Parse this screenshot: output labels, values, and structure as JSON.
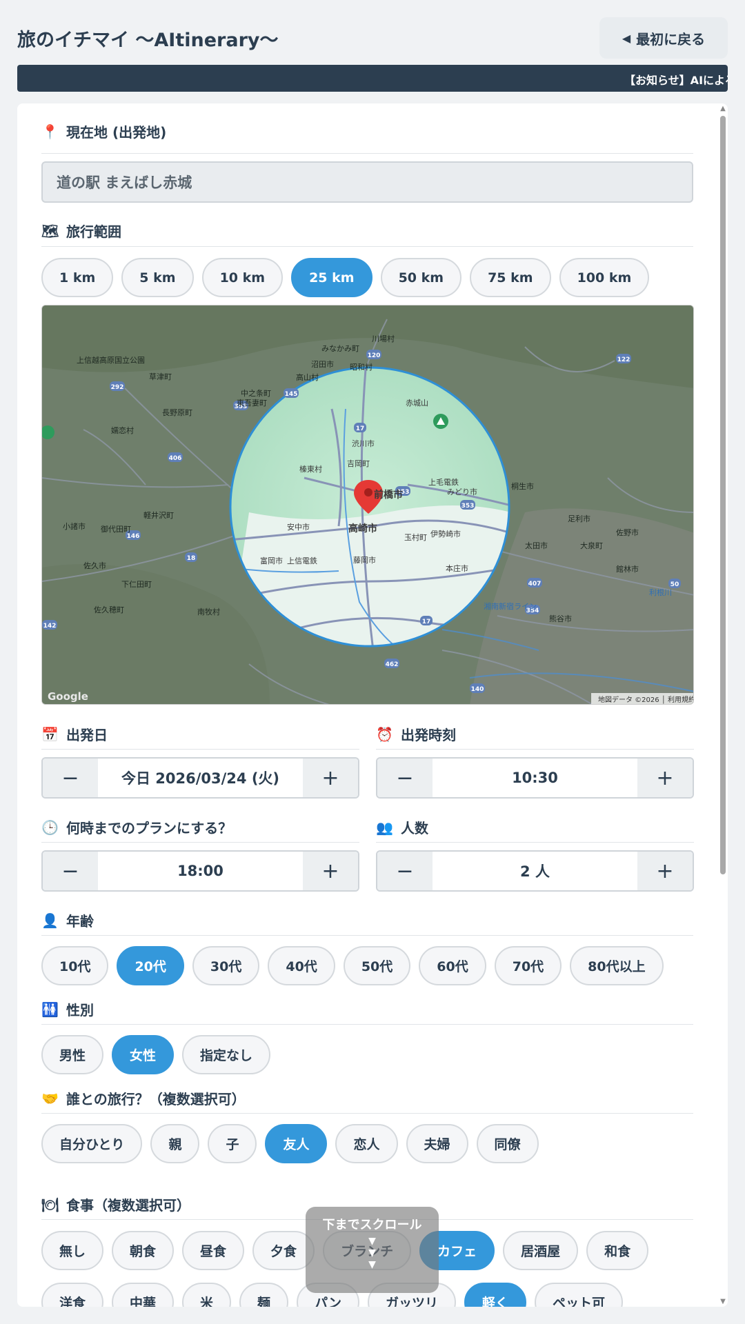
{
  "header": {
    "title": "旅のイチマイ 〜AItinerary〜",
    "back_label": "最初に戻る",
    "notice": "【お知らせ】AIによる"
  },
  "sections": {
    "location": {
      "title": "現在地 (出発地)",
      "value": "道の駅 まえばし赤城"
    },
    "range": {
      "title": "旅行範囲",
      "options": [
        "1 km",
        "5 km",
        "10 km",
        "25 km",
        "50 km",
        "75 km",
        "100 km"
      ],
      "selected": "25 km"
    },
    "date": {
      "title": "出発日",
      "value": "今日 2026/03/24 (火)"
    },
    "time": {
      "title": "出発時刻",
      "value": "10:30"
    },
    "until": {
      "title": "何時までのプランにする？",
      "value": "18:00"
    },
    "people": {
      "title": "人数",
      "value": "2 人"
    },
    "age": {
      "title": "年齢",
      "options": [
        "10代",
        "20代",
        "30代",
        "40代",
        "50代",
        "60代",
        "70代",
        "80代以上"
      ],
      "selected": "20代"
    },
    "gender": {
      "title": "性別",
      "options": [
        "男性",
        "女性",
        "指定なし"
      ],
      "selected": "女性"
    },
    "companion": {
      "title": "誰との旅行？（複数選択可）",
      "options": [
        "自分ひとり",
        "親",
        "子",
        "友人",
        "恋人",
        "夫婦",
        "同僚"
      ],
      "selected": [
        "友人"
      ]
    },
    "meal": {
      "title": "食事（複数選択可）",
      "options": [
        "無し",
        "朝食",
        "昼食",
        "夕食",
        "ブランチ",
        "カフェ",
        "居酒屋",
        "和食"
      ],
      "selected": [
        "カフェ"
      ]
    },
    "meal2": {
      "options": [
        "洋食",
        "中華",
        "米",
        "麺",
        "パン",
        "ガッツリ",
        "軽く",
        "ペット可"
      ],
      "selected": [
        "軽く"
      ]
    }
  },
  "map": {
    "labels": [
      "みなかみ町",
      "川場村",
      "沼田市",
      "昭和村",
      "高山村",
      "中之条町",
      "東吾妻町",
      "赤城山",
      "長野原町",
      "嬬恋村",
      "渋川市",
      "榛東村",
      "吉岡町",
      "上毛電鉄",
      "みどり市",
      "桐生市",
      "前橋市",
      "安中市",
      "高崎市",
      "玉村町",
      "伊勢崎市",
      "太田市",
      "足利市",
      "佐野市",
      "富岡市",
      "上信電鉄",
      "藤岡市",
      "本庄市",
      "大泉町",
      "館林市",
      "佐久市",
      "下仁田町",
      "軽井沢町",
      "御代田町",
      "小諸市",
      "南牧村",
      "佐久穂町",
      "熊谷市",
      "上信越高原国立公園",
      "草津町",
      "利根川",
      "湘南新宿ライン"
    ],
    "attribution": "地図データ ©2026 │ 利用規約",
    "google": "Google"
  },
  "scroll_hint": {
    "label": "下までスクロール"
  },
  "icons": {
    "location": "pin-icon",
    "range": "map-icon",
    "date": "calendar-icon",
    "time": "alarm-clock-icon",
    "until": "clock-icon",
    "people": "people-icon",
    "age": "person-icon",
    "gender": "restroom-icon",
    "companion": "handshake-icon",
    "meal": "plate-icon"
  },
  "colors": {
    "accent": "#3498db",
    "dark": "#2c3e50",
    "circle": "#2e8fd6"
  }
}
